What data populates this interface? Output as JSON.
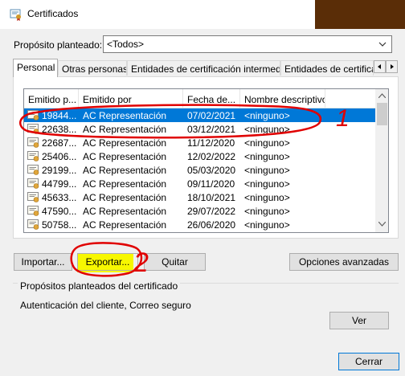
{
  "window": {
    "title": "Certificados"
  },
  "purpose": {
    "label": "Propósito planteado:",
    "selected": "<Todos>"
  },
  "tabs": [
    {
      "label": "Personal"
    },
    {
      "label": "Otras personas"
    },
    {
      "label": "Entidades de certificación intermedias"
    },
    {
      "label": "Entidades de certificac"
    }
  ],
  "columns": [
    "Emitido p...",
    "Emitido por",
    "Fecha de...",
    "Nombre descriptivo"
  ],
  "rows": [
    {
      "issued_to": "19844...",
      "issued_by": "AC Representación",
      "date": "07/02/2021",
      "name": "<ninguno>",
      "selected": true
    },
    {
      "issued_to": "22638...",
      "issued_by": "AC Representación",
      "date": "03/12/2021",
      "name": "<ninguno>"
    },
    {
      "issued_to": "22687...",
      "issued_by": "AC Representación",
      "date": "11/12/2020",
      "name": "<ninguno>"
    },
    {
      "issued_to": "25406...",
      "issued_by": "AC Representación",
      "date": "12/02/2022",
      "name": "<ninguno>"
    },
    {
      "issued_to": "29199...",
      "issued_by": "AC Representación",
      "date": "05/03/2020",
      "name": "<ninguno>"
    },
    {
      "issued_to": "44799...",
      "issued_by": "AC Representación",
      "date": "09/11/2020",
      "name": "<ninguno>"
    },
    {
      "issued_to": "45633...",
      "issued_by": "AC Representación",
      "date": "18/10/2021",
      "name": "<ninguno>"
    },
    {
      "issued_to": "47590...",
      "issued_by": "AC Representación",
      "date": "29/07/2022",
      "name": "<ninguno>"
    },
    {
      "issued_to": "50758...",
      "issued_by": "AC Representación",
      "date": "26/06/2020",
      "name": "<ninguno>"
    }
  ],
  "buttons": {
    "import": "Importar...",
    "export": "Exportar...",
    "remove": "Quitar",
    "advanced": "Opciones avanzadas",
    "view": "Ver",
    "close": "Cerrar"
  },
  "purposes_group": {
    "title": "Propósitos planteados del certificado",
    "text": "Autenticación del cliente, Correo seguro"
  },
  "annotations": {
    "mark1": "1",
    "mark2": "2"
  },
  "colors": {
    "selection": "#0078d7",
    "annotation": "#e00000",
    "highlight": "#f7f700"
  }
}
